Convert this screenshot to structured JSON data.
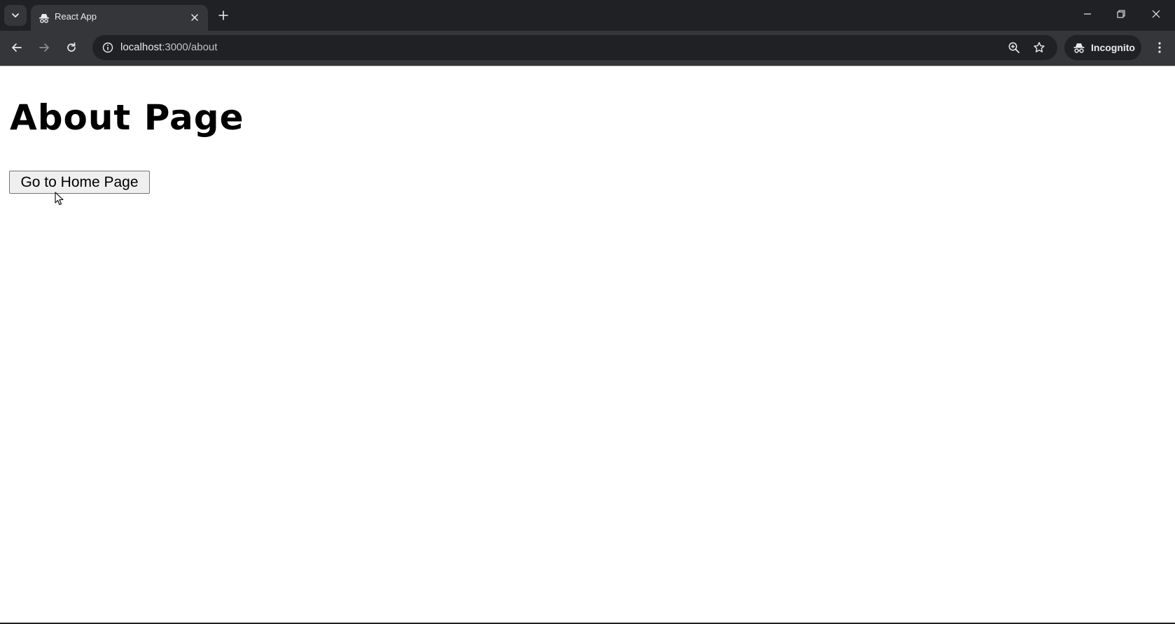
{
  "browser": {
    "tab": {
      "title": "React App",
      "favicon": "incognito-tab-icon"
    },
    "address_bar": {
      "host": "localhost",
      "path": ":3000/about"
    },
    "profile": {
      "label": "Incognito"
    },
    "colors": {
      "frame": "#202124",
      "toolbar": "#35363a",
      "text": "#e8eaed"
    }
  },
  "page": {
    "heading": "About Page",
    "home_button_label": "Go to Home Page"
  }
}
